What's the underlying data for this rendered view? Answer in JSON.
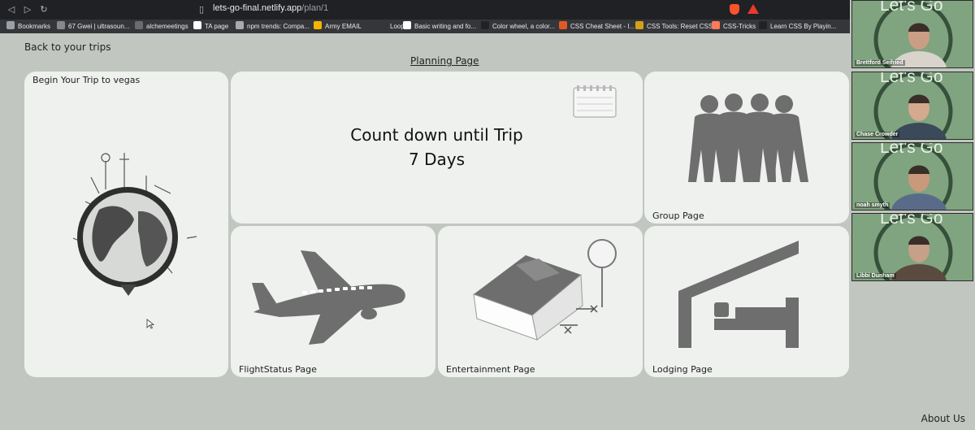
{
  "browser": {
    "url_domain": "lets-go-final.netlify.app",
    "url_path": "/plan/1",
    "bookmarks": [
      {
        "label": "Bookmarks",
        "color": "#9aa0a6"
      },
      {
        "label": "67 Gwei | ultrasoun...",
        "color": "#888888"
      },
      {
        "label": "alchemeetings",
        "color": "#6b6b6b"
      },
      {
        "label": "TA page",
        "color": "#ffffff"
      },
      {
        "label": "npm trends: Compa...",
        "color": "#aaaaaa"
      },
      {
        "label": "Army EMAIL",
        "color": "#f4b400"
      },
      {
        "label": "Loops",
        "color": "#35363a"
      },
      {
        "label": "Basic writing and fo...",
        "color": "#ffffff"
      },
      {
        "label": "Color wheel, a color...",
        "color": "#222222"
      },
      {
        "label": "CSS Cheat Sheet - I...",
        "color": "#e25822"
      },
      {
        "label": "CSS Tools: Reset CSS",
        "color": "#d4a017"
      },
      {
        "label": "CSS-Tricks",
        "color": "#ff7a59"
      },
      {
        "label": "Learn CSS By Playin...",
        "color": "#222222"
      }
    ]
  },
  "page": {
    "back_link": "Back to your trips",
    "title": "Planning Page",
    "about": "About Us"
  },
  "cards": {
    "begin_trip": "Begin Your Trip to vegas",
    "countdown_heading": "Count down until Trip",
    "countdown_value": "7 Days",
    "group": "Group Page",
    "flight": "FlightStatus Page",
    "entertainment": "Entertainment Page",
    "lodging": "Lodging Page"
  },
  "video_call": {
    "brand": "Let's Go",
    "participants": [
      "Brettford Seifried",
      "Chase Crowder",
      "noah smyth",
      "Libbi Dunham"
    ]
  },
  "colors": {
    "page_bg": "#c1c7c0",
    "card_bg": "#eef1ee",
    "illustration": "#6e6e6e",
    "tile_bg": "#7fa47f"
  }
}
